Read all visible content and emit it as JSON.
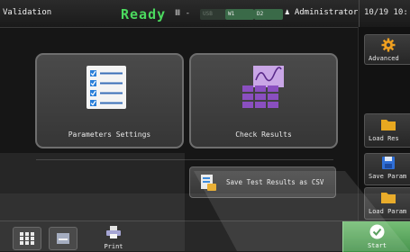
{
  "header": {
    "mode": "Validation",
    "status": "Ready",
    "device_group": "Ⅲ -",
    "badges": {
      "usb": "USB",
      "wifi1": "W1",
      "wifi2": "D2"
    },
    "user": "Administrator",
    "clock": "10/19 10:"
  },
  "right_panel": {
    "advanced_label": "Advanced",
    "load_results_label": "Load Res",
    "save_params_label": "Save Param",
    "load_params_label": "Load Param"
  },
  "tiles": {
    "parameters_label": "Parameters Settings",
    "check_results_label": "Check Results"
  },
  "csv_button_label": "Save Test Results as CSV",
  "bottom": {
    "print_label": "Print",
    "start_label": "Start"
  },
  "colors": {
    "ready": "#4bd95e",
    "start": "#4f9f55",
    "folder": "#e8a820",
    "accent_purple": "#8a4fc0",
    "save_blue": "#2f6fd6"
  }
}
